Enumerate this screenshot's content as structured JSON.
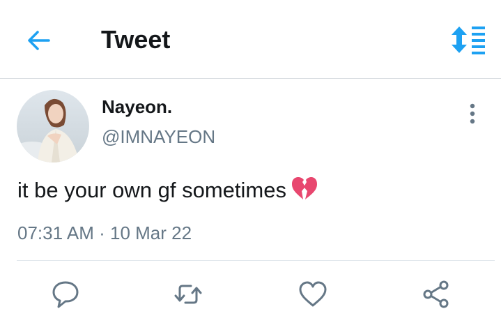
{
  "header": {
    "title": "Tweet",
    "back_icon": "arrow-left-icon",
    "sort_icon": "sort-lines-icon"
  },
  "tweet": {
    "author_name": "Nayeon.",
    "author_handle": "@IMNAYEON",
    "text": "it be your own gf sometimes",
    "emoji": "broken-heart",
    "time": "07:31 AM",
    "separator": "·",
    "date": "10 Mar 22"
  },
  "actions": {
    "reply_icon": "reply-bubble-icon",
    "retweet_icon": "retweet-icon",
    "like_icon": "heart-outline-icon",
    "share_icon": "share-icon"
  },
  "colors": {
    "accent": "#1da1f2",
    "text_primary": "#14171a",
    "text_secondary": "#657786",
    "divider": "#e1e8ed",
    "icon_grey": "#657786",
    "broken_heart": "#e8476f"
  }
}
